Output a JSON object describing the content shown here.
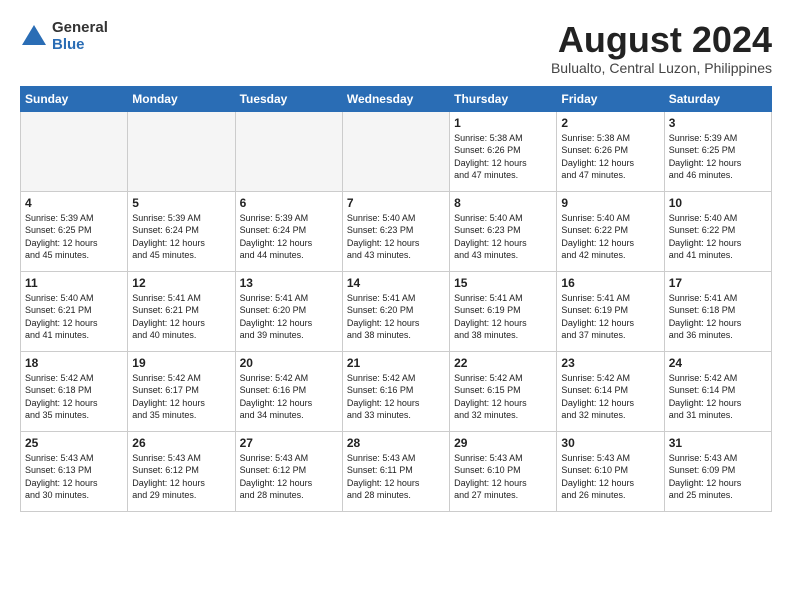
{
  "header": {
    "logo_general": "General",
    "logo_blue": "Blue",
    "month_title": "August 2024",
    "location": "Bulualto, Central Luzon, Philippines"
  },
  "days_of_week": [
    "Sunday",
    "Monday",
    "Tuesday",
    "Wednesday",
    "Thursday",
    "Friday",
    "Saturday"
  ],
  "weeks": [
    [
      {
        "day": "",
        "info": ""
      },
      {
        "day": "",
        "info": ""
      },
      {
        "day": "",
        "info": ""
      },
      {
        "day": "",
        "info": ""
      },
      {
        "day": "1",
        "info": "Sunrise: 5:38 AM\nSunset: 6:26 PM\nDaylight: 12 hours\nand 47 minutes."
      },
      {
        "day": "2",
        "info": "Sunrise: 5:38 AM\nSunset: 6:26 PM\nDaylight: 12 hours\nand 47 minutes."
      },
      {
        "day": "3",
        "info": "Sunrise: 5:39 AM\nSunset: 6:25 PM\nDaylight: 12 hours\nand 46 minutes."
      }
    ],
    [
      {
        "day": "4",
        "info": "Sunrise: 5:39 AM\nSunset: 6:25 PM\nDaylight: 12 hours\nand 45 minutes."
      },
      {
        "day": "5",
        "info": "Sunrise: 5:39 AM\nSunset: 6:24 PM\nDaylight: 12 hours\nand 45 minutes."
      },
      {
        "day": "6",
        "info": "Sunrise: 5:39 AM\nSunset: 6:24 PM\nDaylight: 12 hours\nand 44 minutes."
      },
      {
        "day": "7",
        "info": "Sunrise: 5:40 AM\nSunset: 6:23 PM\nDaylight: 12 hours\nand 43 minutes."
      },
      {
        "day": "8",
        "info": "Sunrise: 5:40 AM\nSunset: 6:23 PM\nDaylight: 12 hours\nand 43 minutes."
      },
      {
        "day": "9",
        "info": "Sunrise: 5:40 AM\nSunset: 6:22 PM\nDaylight: 12 hours\nand 42 minutes."
      },
      {
        "day": "10",
        "info": "Sunrise: 5:40 AM\nSunset: 6:22 PM\nDaylight: 12 hours\nand 41 minutes."
      }
    ],
    [
      {
        "day": "11",
        "info": "Sunrise: 5:40 AM\nSunset: 6:21 PM\nDaylight: 12 hours\nand 41 minutes."
      },
      {
        "day": "12",
        "info": "Sunrise: 5:41 AM\nSunset: 6:21 PM\nDaylight: 12 hours\nand 40 minutes."
      },
      {
        "day": "13",
        "info": "Sunrise: 5:41 AM\nSunset: 6:20 PM\nDaylight: 12 hours\nand 39 minutes."
      },
      {
        "day": "14",
        "info": "Sunrise: 5:41 AM\nSunset: 6:20 PM\nDaylight: 12 hours\nand 38 minutes."
      },
      {
        "day": "15",
        "info": "Sunrise: 5:41 AM\nSunset: 6:19 PM\nDaylight: 12 hours\nand 38 minutes."
      },
      {
        "day": "16",
        "info": "Sunrise: 5:41 AM\nSunset: 6:19 PM\nDaylight: 12 hours\nand 37 minutes."
      },
      {
        "day": "17",
        "info": "Sunrise: 5:41 AM\nSunset: 6:18 PM\nDaylight: 12 hours\nand 36 minutes."
      }
    ],
    [
      {
        "day": "18",
        "info": "Sunrise: 5:42 AM\nSunset: 6:18 PM\nDaylight: 12 hours\nand 35 minutes."
      },
      {
        "day": "19",
        "info": "Sunrise: 5:42 AM\nSunset: 6:17 PM\nDaylight: 12 hours\nand 35 minutes."
      },
      {
        "day": "20",
        "info": "Sunrise: 5:42 AM\nSunset: 6:16 PM\nDaylight: 12 hours\nand 34 minutes."
      },
      {
        "day": "21",
        "info": "Sunrise: 5:42 AM\nSunset: 6:16 PM\nDaylight: 12 hours\nand 33 minutes."
      },
      {
        "day": "22",
        "info": "Sunrise: 5:42 AM\nSunset: 6:15 PM\nDaylight: 12 hours\nand 32 minutes."
      },
      {
        "day": "23",
        "info": "Sunrise: 5:42 AM\nSunset: 6:14 PM\nDaylight: 12 hours\nand 32 minutes."
      },
      {
        "day": "24",
        "info": "Sunrise: 5:42 AM\nSunset: 6:14 PM\nDaylight: 12 hours\nand 31 minutes."
      }
    ],
    [
      {
        "day": "25",
        "info": "Sunrise: 5:43 AM\nSunset: 6:13 PM\nDaylight: 12 hours\nand 30 minutes."
      },
      {
        "day": "26",
        "info": "Sunrise: 5:43 AM\nSunset: 6:12 PM\nDaylight: 12 hours\nand 29 minutes."
      },
      {
        "day": "27",
        "info": "Sunrise: 5:43 AM\nSunset: 6:12 PM\nDaylight: 12 hours\nand 28 minutes."
      },
      {
        "day": "28",
        "info": "Sunrise: 5:43 AM\nSunset: 6:11 PM\nDaylight: 12 hours\nand 28 minutes."
      },
      {
        "day": "29",
        "info": "Sunrise: 5:43 AM\nSunset: 6:10 PM\nDaylight: 12 hours\nand 27 minutes."
      },
      {
        "day": "30",
        "info": "Sunrise: 5:43 AM\nSunset: 6:10 PM\nDaylight: 12 hours\nand 26 minutes."
      },
      {
        "day": "31",
        "info": "Sunrise: 5:43 AM\nSunset: 6:09 PM\nDaylight: 12 hours\nand 25 minutes."
      }
    ]
  ]
}
